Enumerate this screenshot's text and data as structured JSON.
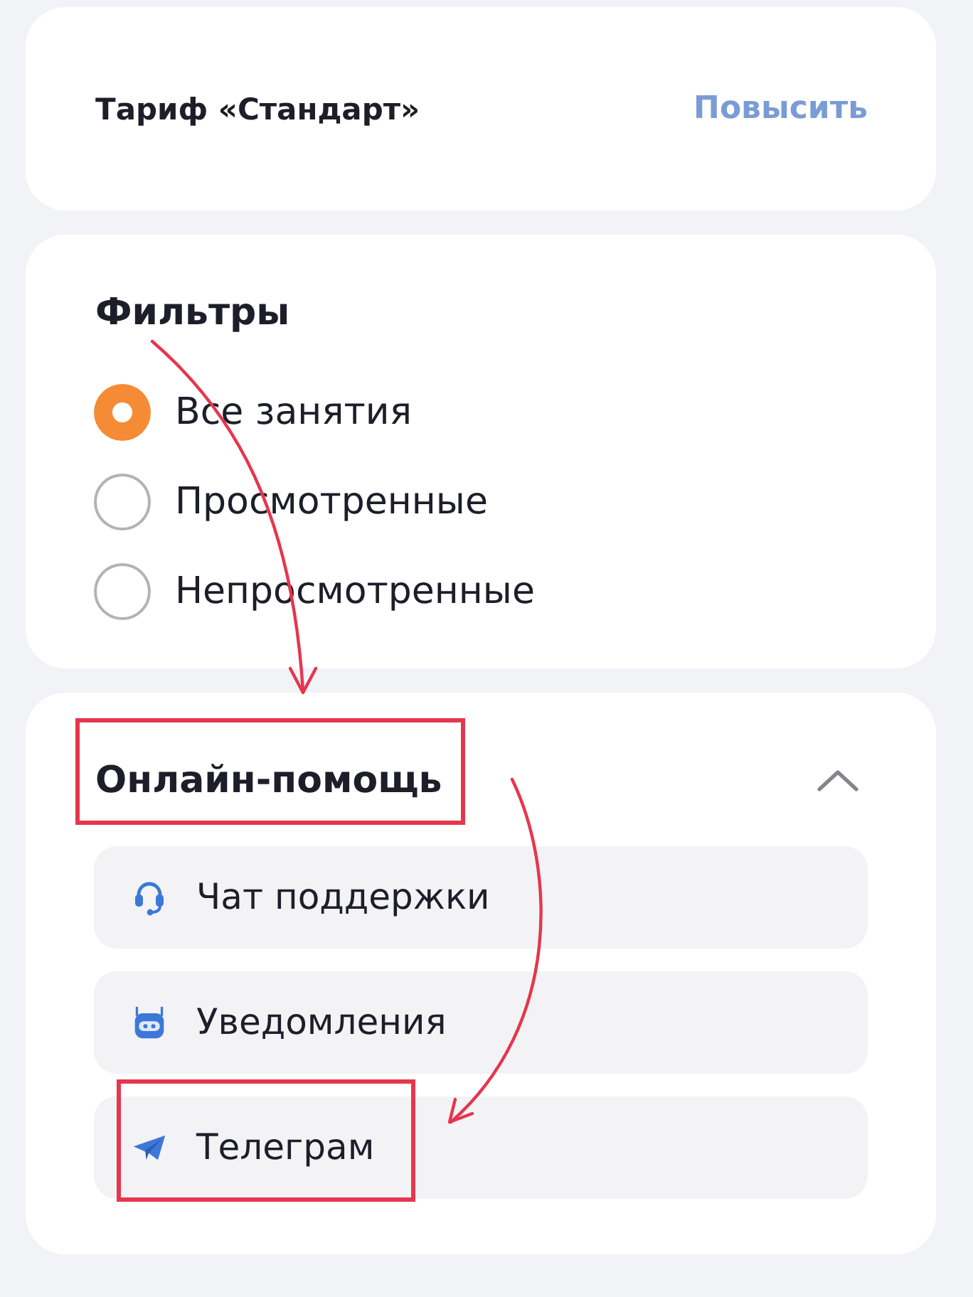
{
  "plan": {
    "label": "Тариф «Стандарт»",
    "action": "Повысить"
  },
  "filters": {
    "title": "Фильтры",
    "options": [
      {
        "label": "Все занятия",
        "selected": true
      },
      {
        "label": "Просмотренные",
        "selected": false
      },
      {
        "label": "Непросмотренные",
        "selected": false
      }
    ]
  },
  "help": {
    "title": "Онлайн-помощь",
    "highlighted": true,
    "expanded": true,
    "items": [
      {
        "kind": "headset",
        "label": "Чат поддержки",
        "highlighted": false
      },
      {
        "kind": "robot",
        "label": "Уведомления",
        "highlighted": false
      },
      {
        "kind": "plane",
        "label": "Телеграм",
        "highlighted": true
      }
    ]
  }
}
